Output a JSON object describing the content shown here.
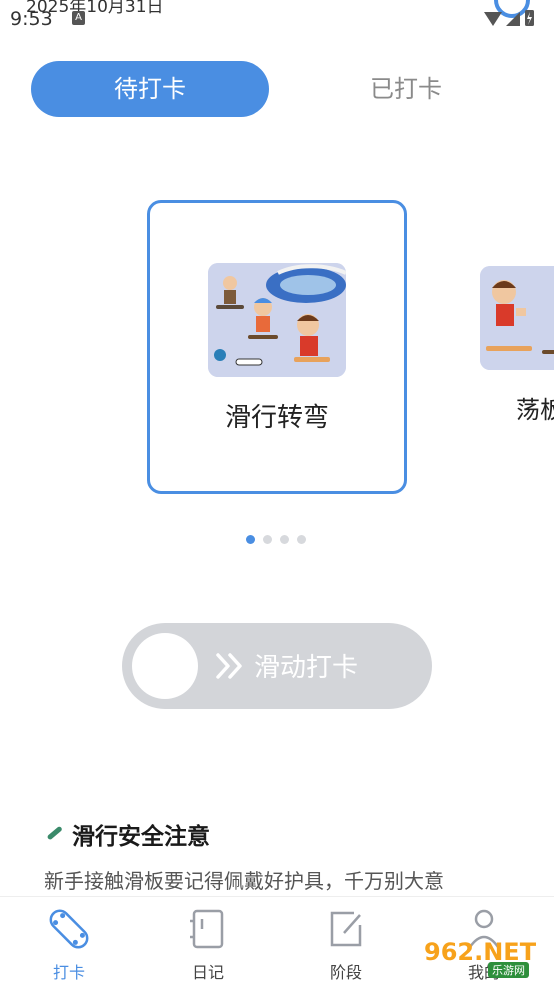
{
  "status_bar": {
    "date": "2025年10月31日",
    "time": "9:53",
    "badge": "A"
  },
  "tabs": {
    "pending": "待打卡",
    "done": "已打卡"
  },
  "cards": [
    {
      "title": "滑行转弯",
      "image": "skateboard-kids-illustration"
    },
    {
      "title": "荡板",
      "image": "skateboard-kids-illustration"
    }
  ],
  "pager": {
    "count": 4,
    "active_index": 0
  },
  "slider": {
    "label": "滑动打卡",
    "icon": "double-chevron-right-icon"
  },
  "safety": {
    "icon": "skateboard-icon",
    "title": "滑行安全注意",
    "description": "新手接触滑板要记得佩戴好护具，千万别大意"
  },
  "bottom_nav": {
    "items": [
      {
        "label": "打卡",
        "icon": "skateboard-icon",
        "active": true
      },
      {
        "label": "日记",
        "icon": "notebook-icon",
        "active": false
      },
      {
        "label": "阶段",
        "icon": "edit-icon",
        "active": false
      },
      {
        "label": "我的",
        "icon": "user-icon",
        "active": false
      }
    ]
  },
  "watermark": {
    "text": "962.NET",
    "sub": "乐游网"
  },
  "colors": {
    "accent": "#4a8ee2",
    "slider_bg": "#d3d5d9",
    "inactive_tab": "#8a8a8a"
  }
}
